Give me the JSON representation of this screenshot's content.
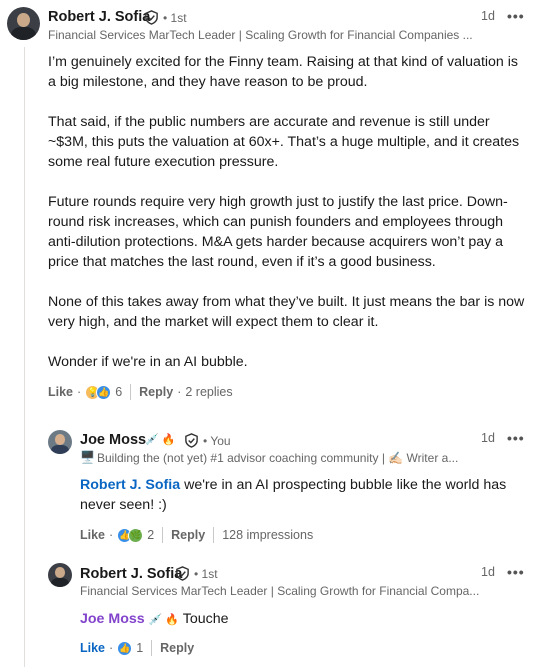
{
  "main_comment": {
    "author": "Robert J. Sofia",
    "degree": "• 1st",
    "headline": "Financial Services MarTech Leader | Scaling Growth for Financial Companies ...",
    "time": "1d",
    "more": "•••",
    "paragraphs": [
      "I’m genuinely excited for the Finny team. Raising at that kind of valuation is a big milestone, and they have reason to be proud.",
      "That said, if the public numbers are accurate and revenue is still under ~$3M, this puts the valuation at 60x+. That’s a huge multiple, and it creates some real future execution pressure.",
      "Future rounds require very high growth just to justify the last price. Down-round risk increases, which can punish founders and employees through anti-dilution protections. M&A gets harder because acquirers won’t pay a price that matches the last round, even if it’s a good business.",
      "None of this takes away from what they’ve built. It just means the bar is now very high, and the market will expect them to clear it.",
      "Wonder if we're in an AI bubble."
    ],
    "actions": {
      "like_label": "Like",
      "reaction_count": "6",
      "reply_label": "Reply",
      "replies_text": "2 replies"
    }
  },
  "reply_1": {
    "author": "Joe Moss",
    "author_emojis": "💉 🔥",
    "degree": "• You",
    "headline_emoji": "🖥️",
    "headline": "Building the (not yet) #1 advisor coaching community | ✍🏻 Writer a...",
    "time": "1d",
    "more": "•••",
    "mention": "Robert J. Sofia",
    "text": " we're in an AI prospecting bubble like the world has never seen! :)",
    "actions": {
      "like_label": "Like",
      "reaction_count": "2",
      "reply_label": "Reply",
      "impressions": "128 impressions"
    }
  },
  "reply_2": {
    "author": "Robert J. Sofia",
    "degree": "• 1st",
    "headline": "Financial Services MarTech Leader | Scaling Growth for Financial Compa...",
    "time": "1d",
    "more": "•••",
    "mention": "Joe Moss",
    "mention_emojis": "💉 🔥",
    "text": " Touche",
    "actions": {
      "like_label": "Like",
      "reaction_count": "1",
      "reply_label": "Reply"
    }
  },
  "colors": {
    "accent_blue": "#0a66c2",
    "mention_purple": "#8344cc",
    "muted_text": "#666666"
  },
  "icons": [
    "verified-shield-icon",
    "more-options-icon",
    "like-reaction-icon",
    "insightful-reaction-icon",
    "support-reaction-icon"
  ]
}
